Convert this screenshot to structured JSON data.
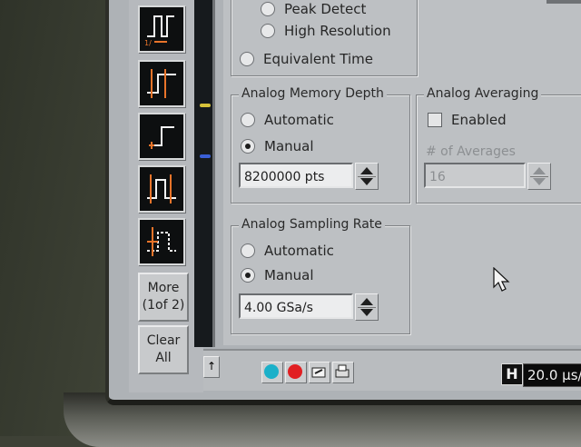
{
  "toolbar": {
    "more_line1": "More",
    "more_line2": "(1of 2)",
    "clear_line1": "Clear",
    "clear_line2": "All",
    "icons": [
      "pulse-width-icon",
      "rise-time-icon",
      "edge-icon",
      "fall-time-icon",
      "period-icon"
    ]
  },
  "acquisition": {
    "peak_detect": "Peak Detect",
    "high_resolution": "High Resolution",
    "equivalent_time": "Equivalent Time"
  },
  "memory_depth": {
    "title": "Analog Memory Depth",
    "automatic": "Automatic",
    "manual": "Manual",
    "selected": "manual",
    "value": "8200000 pts"
  },
  "averaging": {
    "title": "Analog Averaging",
    "enabled_label": "Enabled",
    "enabled": false,
    "count_label": "# of Averages",
    "count_value": "16"
  },
  "sampling_rate": {
    "title": "Analog Sampling Rate",
    "automatic": "Automatic",
    "manual": "Manual",
    "selected": "manual",
    "value": "4.00 GSa/s"
  },
  "statusbar": {
    "horizontal_label": "H",
    "timebase": "20.0 µs/"
  },
  "colors": {
    "accent_orange": "#e8742a",
    "run_cyan": "#1bb0c9",
    "stop_red": "#e11f22",
    "dialog_bg": "#bdc0c3"
  }
}
